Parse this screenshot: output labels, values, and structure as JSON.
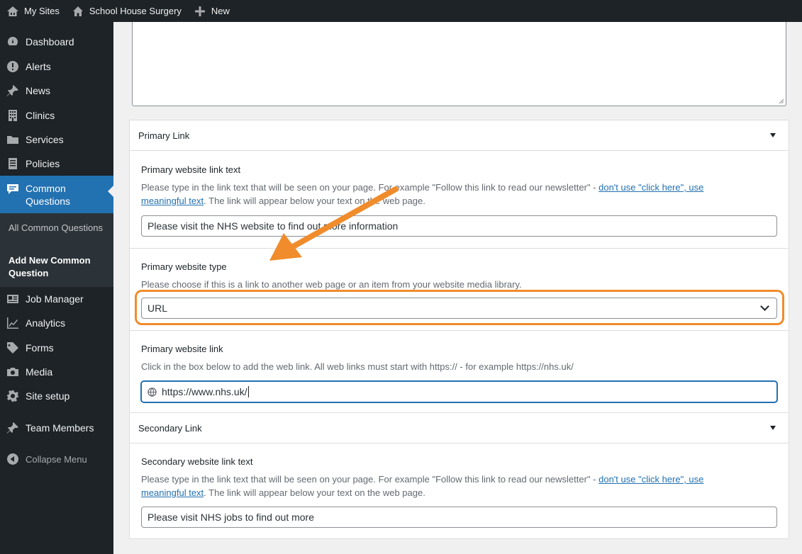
{
  "adminbar": {
    "my_sites": "My Sites",
    "site_name": "School House Surgery",
    "new": "New"
  },
  "sidebar": {
    "items": [
      {
        "label": "Dashboard",
        "icon": "dashboard-icon"
      },
      {
        "label": "Alerts",
        "icon": "alert-icon"
      },
      {
        "label": "News",
        "icon": "pin-icon"
      },
      {
        "label": "Clinics",
        "icon": "building-icon"
      },
      {
        "label": "Services",
        "icon": "folder-icon"
      },
      {
        "label": "Policies",
        "icon": "document-icon"
      },
      {
        "label": "Common Questions",
        "icon": "comment-icon",
        "current": true
      },
      {
        "label": "Job Manager",
        "icon": "id-card-icon"
      },
      {
        "label": "Analytics",
        "icon": "chart-icon"
      },
      {
        "label": "Forms",
        "icon": "tag-icon"
      },
      {
        "label": "Media",
        "icon": "camera-icon"
      },
      {
        "label": "Site setup",
        "icon": "gear-icon"
      },
      {
        "label": "Team Members",
        "icon": "pin-icon"
      }
    ],
    "submenu": [
      "All Common Questions",
      "Add New Common Question"
    ],
    "collapse": "Collapse Menu"
  },
  "primary": {
    "heading": "Primary Link",
    "link_text_label": "Primary website link text",
    "desc_a": "Please type in the link text that will be seen on your page. For example \"Follow this link to read our newsletter\" - ",
    "desc_link": "don't use \"click here\", use meaningful text",
    "desc_b": ". The link will appear below your text on the web page.",
    "link_text_value": "Please visit the NHS website to find out more information",
    "type_label": "Primary website type",
    "type_desc": "Please choose if this is a link to another web page or an item from your website media library.",
    "type_value": "URL",
    "link_label": "Primary website link",
    "link_desc": "Click in the box below to add the web link. All web links must start with https:// - for example https://nhs.uk/",
    "link_value": "https://www.nhs.uk/"
  },
  "secondary": {
    "heading": "Secondary Link",
    "link_text_label": "Secondary website link text",
    "desc_a": "Please type in the link text that will be seen on your page. For example \"Follow this link to read our newsletter\" - ",
    "desc_link": "don't use \"click here\", use meaningful text",
    "desc_b": ". The link will appear below your text on the web page.",
    "link_text_value": "Please visit NHS jobs to find out more"
  },
  "colors": {
    "highlight": "#f08c2b",
    "accent": "#2271b1",
    "sidebar_bg": "#1d2327"
  }
}
